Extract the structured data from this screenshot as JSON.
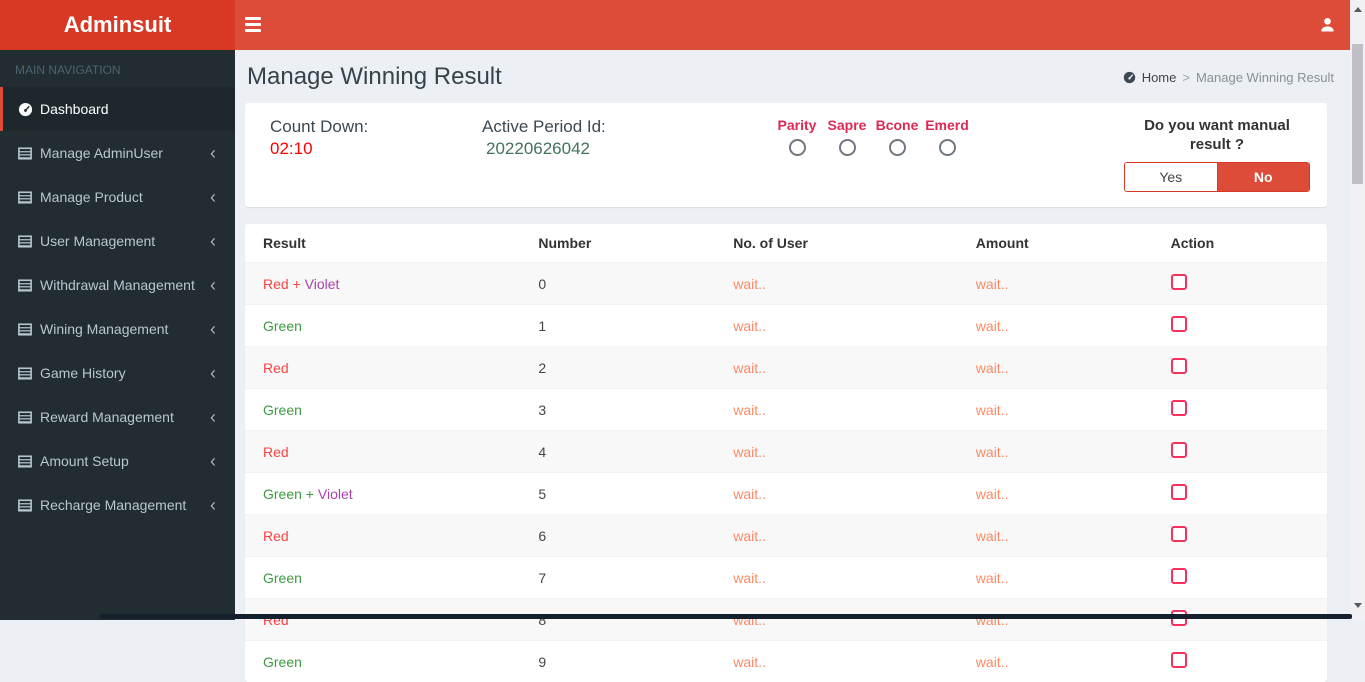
{
  "navbar": {
    "brand": "Adminsuit"
  },
  "sidebar": {
    "section_label": "MAIN NAVIGATION",
    "items": [
      {
        "id": "dashboard",
        "label": "Dashboard",
        "icon": "dashboard-icon",
        "active": true,
        "has_chevron": false
      },
      {
        "id": "manage-adminuser",
        "label": "Manage AdminUser",
        "icon": "table-icon",
        "active": false,
        "has_chevron": true
      },
      {
        "id": "manage-product",
        "label": "Manage Product",
        "icon": "table-icon",
        "active": false,
        "has_chevron": true
      },
      {
        "id": "user-management",
        "label": "User Management",
        "icon": "table-icon",
        "active": false,
        "has_chevron": true
      },
      {
        "id": "withdrawal-management",
        "label": "Withdrawal Management",
        "icon": "table-icon",
        "active": false,
        "has_chevron": true
      },
      {
        "id": "wining-management",
        "label": "Wining Management",
        "icon": "table-icon",
        "active": false,
        "has_chevron": true
      },
      {
        "id": "game-history",
        "label": "Game History",
        "icon": "table-icon",
        "active": false,
        "has_chevron": true
      },
      {
        "id": "reward-management",
        "label": "Reward Management",
        "icon": "table-icon",
        "active": false,
        "has_chevron": true
      },
      {
        "id": "amount-setup",
        "label": "Amount Setup",
        "icon": "table-icon",
        "active": false,
        "has_chevron": true
      },
      {
        "id": "recharge-management",
        "label": "Recharge Management",
        "icon": "table-icon",
        "active": false,
        "has_chevron": true
      }
    ]
  },
  "page": {
    "title": "Manage Winning Result",
    "breadcrumb_home": "Home",
    "breadcrumb_separator": ">",
    "breadcrumb_current": "Manage Winning Result"
  },
  "info_panel": {
    "countdown_label": "Count Down:",
    "countdown_value": "02:10",
    "period_label": "Active Period Id:",
    "period_value": "20220626042",
    "game_options": [
      {
        "label": "Parity",
        "checked": false
      },
      {
        "label": "Sapre",
        "checked": false
      },
      {
        "label": "Bcone",
        "checked": false
      },
      {
        "label": "Emerd",
        "checked": false
      }
    ],
    "manual_question": "Do you want manual result ?",
    "yes_label": "Yes",
    "no_label": "No",
    "manual_selected": "No"
  },
  "results_table": {
    "columns": [
      "Result",
      "Number",
      "No. of User",
      "Amount",
      "Action"
    ],
    "rows": [
      {
        "result_main": "Red +",
        "result_extra": " Violet",
        "color": "red",
        "number": "0",
        "no_of_user": "wait..",
        "amount": "wait.."
      },
      {
        "result_main": "Green",
        "result_extra": "",
        "color": "green",
        "number": "1",
        "no_of_user": "wait..",
        "amount": "wait.."
      },
      {
        "result_main": "Red",
        "result_extra": "",
        "color": "red",
        "number": "2",
        "no_of_user": "wait..",
        "amount": "wait.."
      },
      {
        "result_main": "Green",
        "result_extra": "",
        "color": "green",
        "number": "3",
        "no_of_user": "wait..",
        "amount": "wait.."
      },
      {
        "result_main": "Red",
        "result_extra": "",
        "color": "red",
        "number": "4",
        "no_of_user": "wait..",
        "amount": "wait.."
      },
      {
        "result_main": "Green +",
        "result_extra": " Violet",
        "color": "green",
        "number": "5",
        "no_of_user": "wait..",
        "amount": "wait.."
      },
      {
        "result_main": "Red",
        "result_extra": "",
        "color": "red",
        "number": "6",
        "no_of_user": "wait..",
        "amount": "wait.."
      },
      {
        "result_main": "Green",
        "result_extra": "",
        "color": "green",
        "number": "7",
        "no_of_user": "wait..",
        "amount": "wait.."
      },
      {
        "result_main": "Red",
        "result_extra": "",
        "color": "red",
        "number": "8",
        "no_of_user": "wait..",
        "amount": "wait.."
      },
      {
        "result_main": "Green",
        "result_extra": "",
        "color": "green",
        "number": "9",
        "no_of_user": "wait..",
        "amount": "wait.."
      }
    ]
  },
  "colors": {
    "navbar_red": "#dd4b39",
    "logo_red": "#d73925",
    "sidebar_dark": "#222d32",
    "countdown_red": "#ff0000",
    "period_green": "#41735a",
    "radio_label_crimson": "#dc2a55",
    "result_red": "#fb4343",
    "result_green": "#3d9a40",
    "result_violet": "#a944a9",
    "wait_orange": "#fd8a63",
    "checkbox_pink": "#f5315d"
  }
}
